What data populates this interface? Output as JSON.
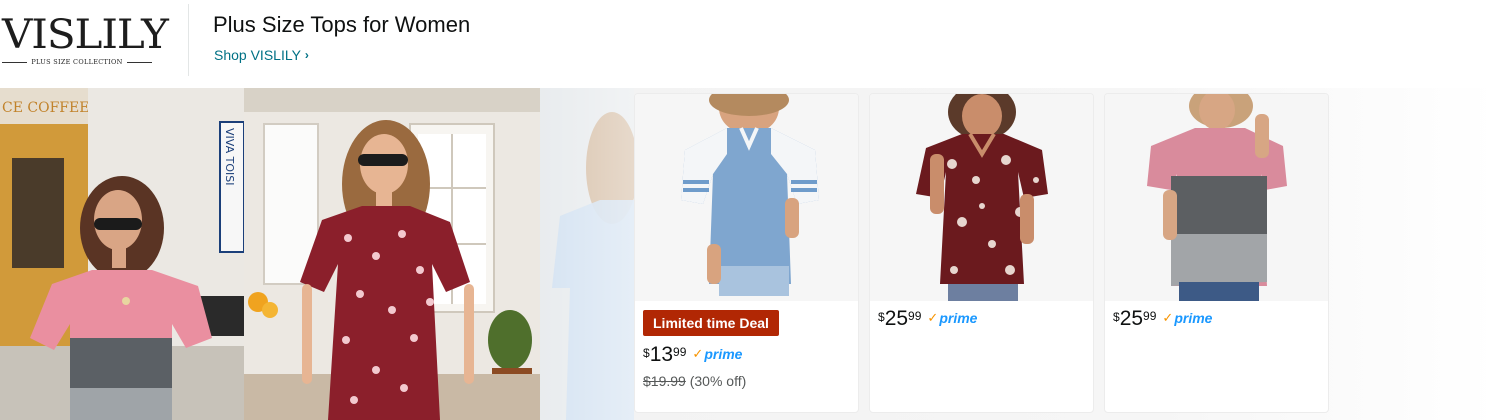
{
  "brand": {
    "logo_text": "VISLILY",
    "logo_tagline": "PLUS SIZE COLLECTION",
    "store_title": "Plus Size Tops for Women",
    "shop_link": "Shop VISLILY"
  },
  "hero": {
    "sign_left": "CE COFFEE",
    "sign_vertical": "VIVA TOISI"
  },
  "products": [
    {
      "deal_badge": "Limited time Deal",
      "currency": "$",
      "price_whole": "13",
      "price_fraction": "99",
      "prime_label": "prime",
      "list_price": "$19.99",
      "discount": "(30% off)",
      "image_icon": "blue-raglan-tee-image",
      "colors": {
        "body": "#7fa6cf",
        "sleeve": "#f4f6f8",
        "stripe": "#6f9ccb"
      }
    },
    {
      "currency": "$",
      "price_whole": "25",
      "price_fraction": "99",
      "prime_label": "prime",
      "image_icon": "floral-henley-top-image",
      "colors": {
        "body": "#6b1a1e",
        "print": "#e7d6cf"
      }
    },
    {
      "currency": "$",
      "price_whole": "25",
      "price_fraction": "99",
      "prime_label": "prime",
      "image_icon": "color-block-tee-image",
      "colors": {
        "top": "#d98b9c",
        "middle": "#5c5f62",
        "bottom": "#a2a5a8"
      }
    }
  ],
  "colors": {
    "link": "#007185",
    "deal": "#b12704",
    "prime_blue": "#1a98ff",
    "prime_check": "#f79400"
  }
}
